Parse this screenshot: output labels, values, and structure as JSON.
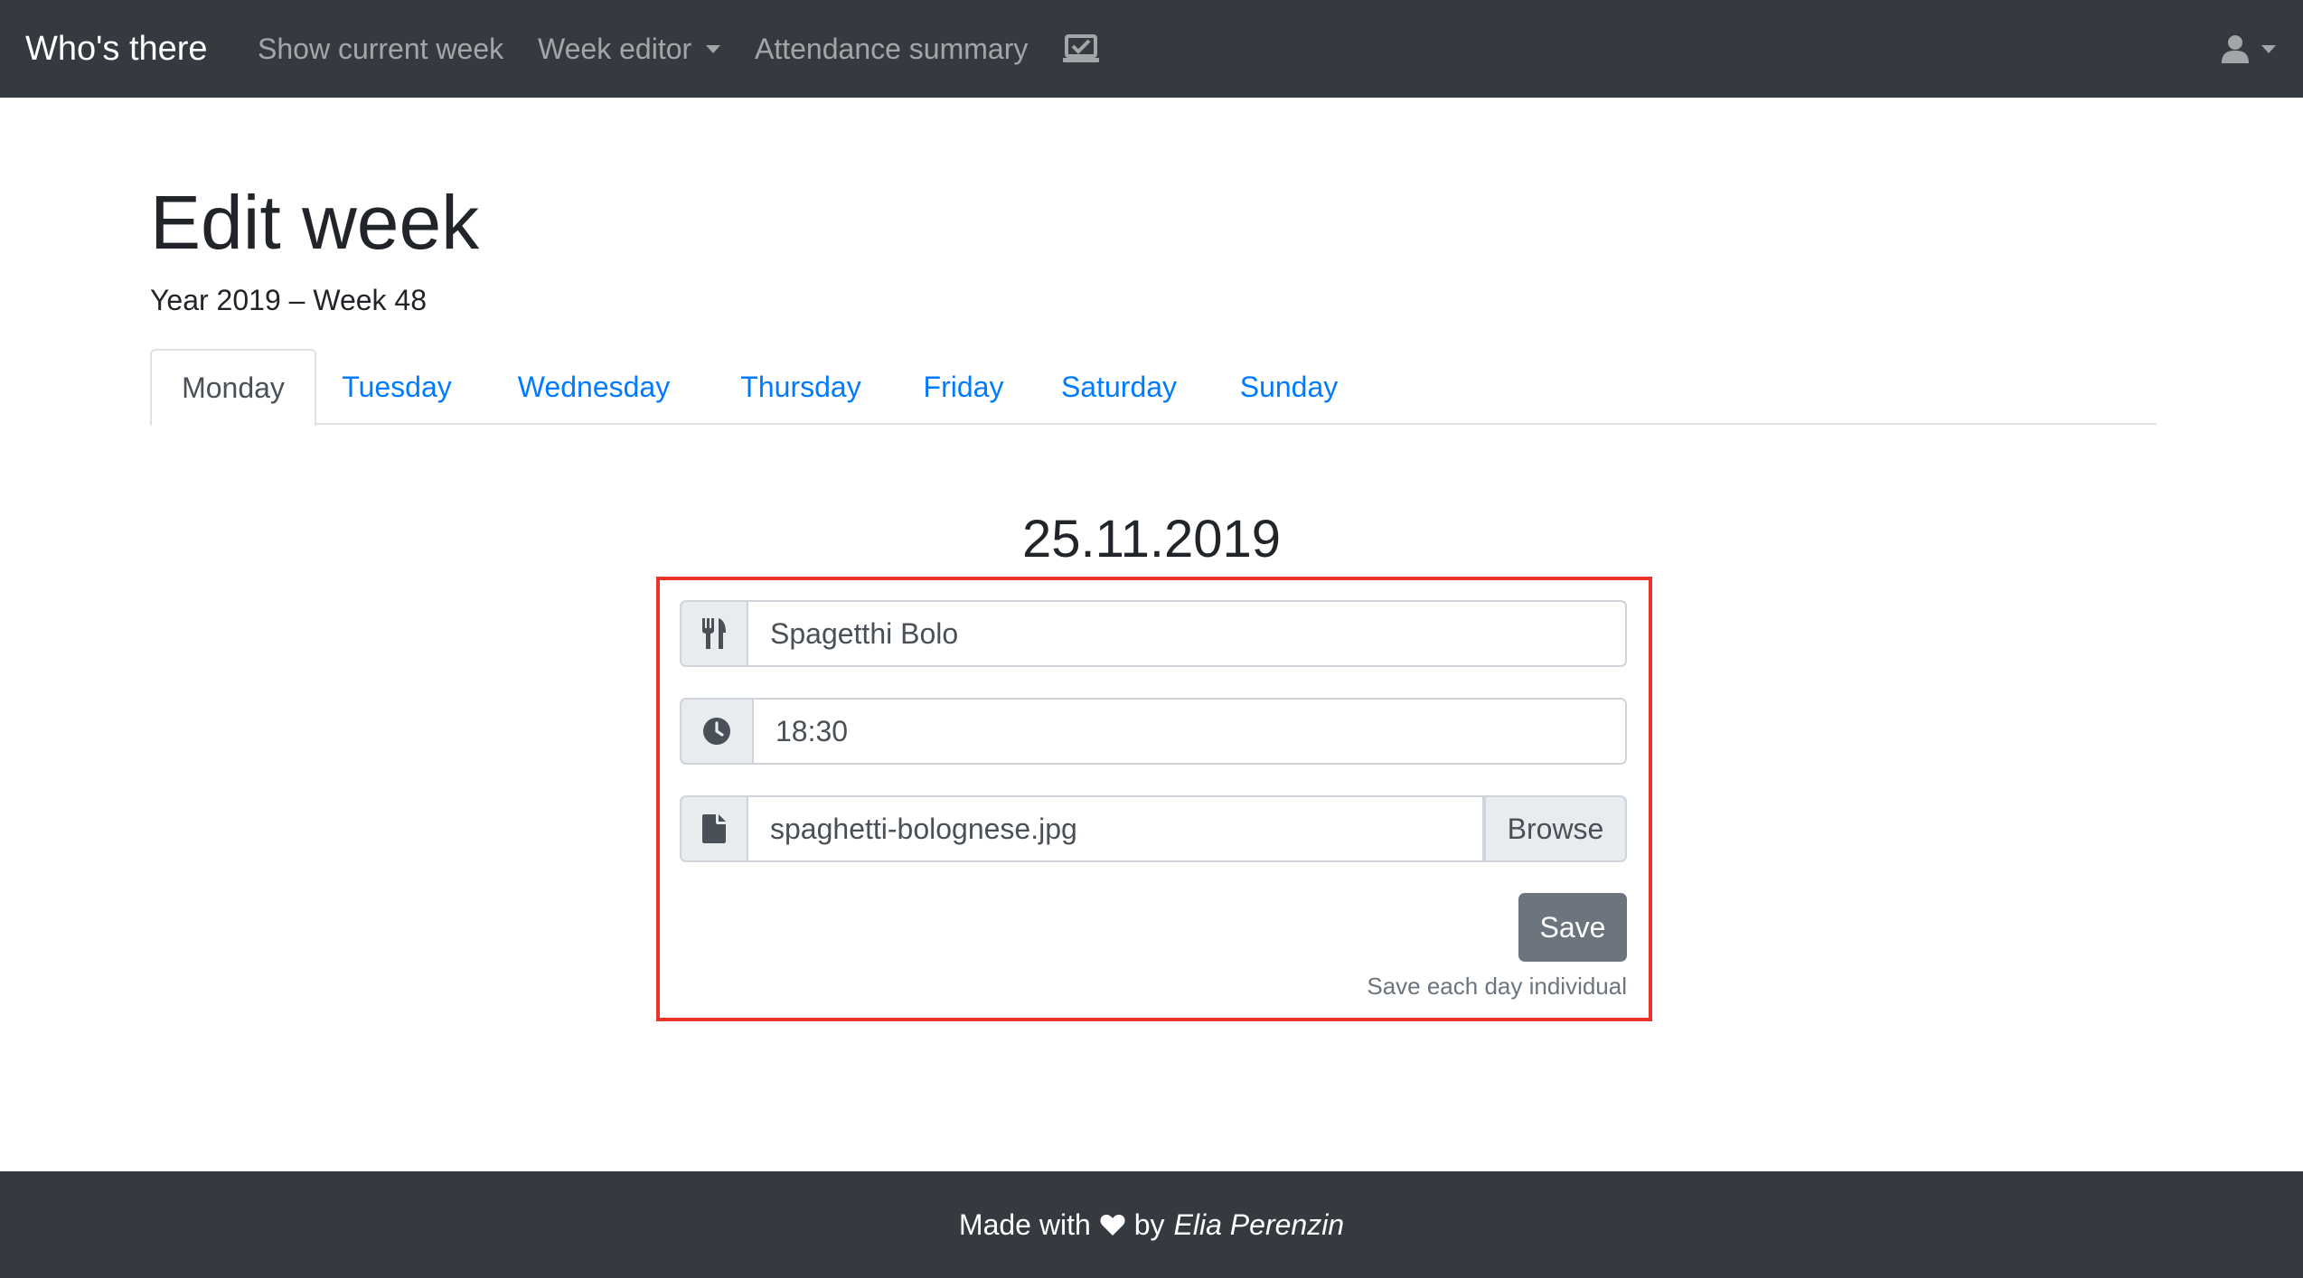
{
  "navbar": {
    "brand": "Who's there",
    "items": {
      "show_current_week": "Show current week",
      "week_editor": "Week editor",
      "attendance_summary": "Attendance summary"
    },
    "icons": {
      "attendance": "laptop-check-icon",
      "user": "user-icon"
    },
    "background": "#343a40"
  },
  "page": {
    "title": "Edit week",
    "subtitle": "Year 2019 – Week 48"
  },
  "tabs": {
    "active": "Monday",
    "items": [
      "Monday",
      "Tuesday",
      "Wednesday",
      "Thursday",
      "Friday",
      "Saturday",
      "Sunday"
    ]
  },
  "day": {
    "date": "25.11.2019",
    "meal": {
      "icon": "utensils-icon",
      "value": "Spagetthi Bolo"
    },
    "time": {
      "icon": "clock-icon",
      "value": "18:30"
    },
    "image": {
      "icon": "file-icon",
      "value": "spaghetti-bolognese.jpg",
      "browse_label": "Browse"
    },
    "save_label": "Save",
    "hint": "Save each day individual"
  },
  "footer": {
    "made_with": "Made with",
    "by": "by",
    "author": "Elia Perenzin",
    "heart_icon": "heart-icon"
  },
  "colors": {
    "link": "#007bff",
    "highlight": "#e8352b",
    "secondary_button": "#6c757d"
  }
}
